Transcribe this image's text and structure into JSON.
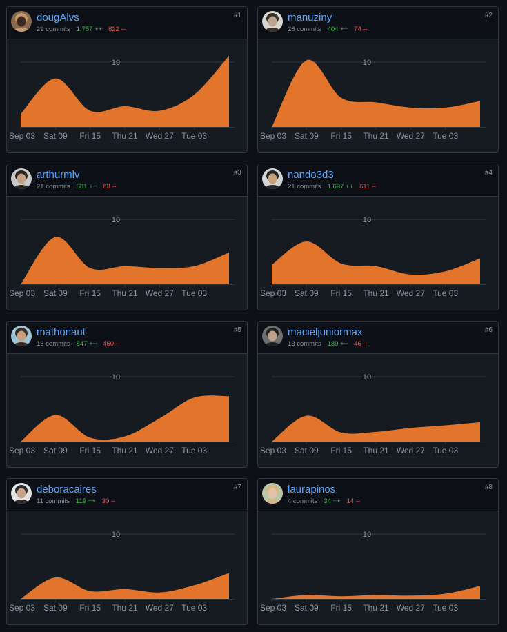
{
  "chart_data": [
    {
      "type": "area",
      "rank": "#1",
      "username": "dougAlvs",
      "commits": "29 commits",
      "additions": "1,757 ++",
      "deletions": "822 --",
      "x_ticks": [
        "Sep 03",
        "Sat 09",
        "Fri 15",
        "Thu 21",
        "Wed 27",
        "Tue 03"
      ],
      "y_gridline": "10",
      "ylim": [
        0,
        13
      ],
      "x": [
        "Sep 03",
        "Sep 09",
        "Sep 15",
        "Sep 21",
        "Sep 27",
        "Oct 03",
        "Oct 07"
      ],
      "values": [
        2,
        7.5,
        2.5,
        3.2,
        2.5,
        5,
        11
      ],
      "fill": "#e2742b",
      "avatar_colors": [
        "#8a6a4e",
        "#c49a6c",
        "#3a2a20"
      ]
    },
    {
      "type": "area",
      "rank": "#2",
      "username": "manuziny",
      "commits": "28 commits",
      "additions": "404 ++",
      "deletions": "74 --",
      "x_ticks": [
        "Sep 03",
        "Sat 09",
        "Fri 15",
        "Thu 21",
        "Wed 27",
        "Tue 03"
      ],
      "y_gridline": "10",
      "ylim": [
        0,
        13
      ],
      "x": [
        "Sep 03",
        "Sep 09",
        "Sep 15",
        "Sep 21",
        "Sep 27",
        "Oct 03",
        "Oct 07"
      ],
      "values": [
        0,
        10.3,
        4.5,
        3.8,
        3,
        3,
        4
      ],
      "fill": "#e2742b",
      "avatar_colors": [
        "#d8d8d0",
        "#3a2e28",
        "#bba58e"
      ]
    },
    {
      "type": "area",
      "rank": "#3",
      "username": "arthurmlv",
      "commits": "21 commits",
      "additions": "581 ++",
      "deletions": "83 --",
      "x_ticks": [
        "Sep 03",
        "Sat 09",
        "Fri 15",
        "Thu 21",
        "Wed 27",
        "Tue 03"
      ],
      "y_gridline": "10",
      "ylim": [
        0,
        13
      ],
      "x": [
        "Sep 03",
        "Sep 09",
        "Sep 15",
        "Sep 21",
        "Sep 27",
        "Oct 03",
        "Oct 07"
      ],
      "values": [
        0,
        7.3,
        2.5,
        2.8,
        2.5,
        2.8,
        4.9
      ],
      "fill": "#e2742b",
      "avatar_colors": [
        "#c7c9ca",
        "#2c2420",
        "#c6a184"
      ]
    },
    {
      "type": "area",
      "rank": "#4",
      "username": "nando3d3",
      "commits": "21 commits",
      "additions": "1,697 ++",
      "deletions": "611 --",
      "x_ticks": [
        "Sep 03",
        "Sat 09",
        "Fri 15",
        "Thu 21",
        "Wed 27",
        "Tue 03"
      ],
      "y_gridline": "10",
      "ylim": [
        0,
        13
      ],
      "x": [
        "Sep 03",
        "Sep 09",
        "Sep 15",
        "Sep 21",
        "Sep 27",
        "Oct 03",
        "Oct 07"
      ],
      "values": [
        3,
        6.6,
        3.2,
        2.8,
        1.5,
        2,
        4
      ],
      "fill": "#e2742b",
      "avatar_colors": [
        "#d4d4d4",
        "#262626",
        "#c7a07c"
      ]
    },
    {
      "type": "area",
      "rank": "#5",
      "username": "mathonaut",
      "commits": "16 commits",
      "additions": "847 ++",
      "deletions": "460 --",
      "x_ticks": [
        "Sep 03",
        "Sat 09",
        "Fri 15",
        "Thu 21",
        "Wed 27",
        "Tue 03"
      ],
      "y_gridline": "10",
      "ylim": [
        0,
        13
      ],
      "x": [
        "Sep 03",
        "Sep 09",
        "Sep 15",
        "Sep 21",
        "Sep 27",
        "Oct 03",
        "Oct 07"
      ],
      "values": [
        0,
        4.1,
        0.6,
        0.8,
        3.6,
        6.8,
        7
      ],
      "fill": "#e2742b",
      "avatar_colors": [
        "#9ec5d6",
        "#3a2c22",
        "#c79f7e"
      ]
    },
    {
      "type": "area",
      "rank": "#6",
      "username": "macieljuniormax",
      "commits": "13 commits",
      "additions": "180 ++",
      "deletions": "46 --",
      "x_ticks": [
        "Sep 03",
        "Sat 09",
        "Fri 15",
        "Thu 21",
        "Wed 27",
        "Tue 03"
      ],
      "y_gridline": "10",
      "ylim": [
        0,
        13
      ],
      "x": [
        "Sep 03",
        "Sep 09",
        "Sep 15",
        "Sep 21",
        "Sep 27",
        "Oct 03",
        "Oct 07"
      ],
      "values": [
        0,
        4,
        1.4,
        1.5,
        2.1,
        2.5,
        3
      ],
      "fill": "#e2742b",
      "avatar_colors": [
        "#6f6f6f",
        "#202020",
        "#bfa089"
      ]
    },
    {
      "type": "area",
      "rank": "#7",
      "username": "deboracaires",
      "commits": "11 commits",
      "additions": "119 ++",
      "deletions": "30 --",
      "x_ticks": [
        "Sep 03",
        "Sat 09",
        "Fri 15",
        "Thu 21",
        "Wed 27",
        "Tue 03"
      ],
      "y_gridline": "10",
      "ylim": [
        0,
        13
      ],
      "x": [
        "Sep 03",
        "Sep 09",
        "Sep 15",
        "Sep 21",
        "Sep 27",
        "Oct 03",
        "Oct 07"
      ],
      "values": [
        0,
        3.3,
        1.2,
        1.5,
        1,
        2.1,
        4
      ],
      "fill": "#e2742b",
      "avatar_colors": [
        "#e4e6e6",
        "#2b2b2b",
        "#c9a38a"
      ]
    },
    {
      "type": "area",
      "rank": "#8",
      "username": "laurapinos",
      "commits": "4 commits",
      "additions": "34 ++",
      "deletions": "14 --",
      "x_ticks": [
        "Sep 03",
        "Sat 09",
        "Fri 15",
        "Thu 21",
        "Wed 27",
        "Tue 03"
      ],
      "y_gridline": "10",
      "ylim": [
        0,
        13
      ],
      "x": [
        "Sep 03",
        "Sep 09",
        "Sep 15",
        "Sep 21",
        "Sep 27",
        "Oct 03",
        "Oct 07"
      ],
      "values": [
        0,
        0.6,
        0.4,
        0.6,
        0.5,
        0.8,
        2
      ],
      "fill": "#e2742b",
      "avatar_colors": [
        "#b9c5a7",
        "#d6b884",
        "#e2c3a8"
      ]
    }
  ]
}
